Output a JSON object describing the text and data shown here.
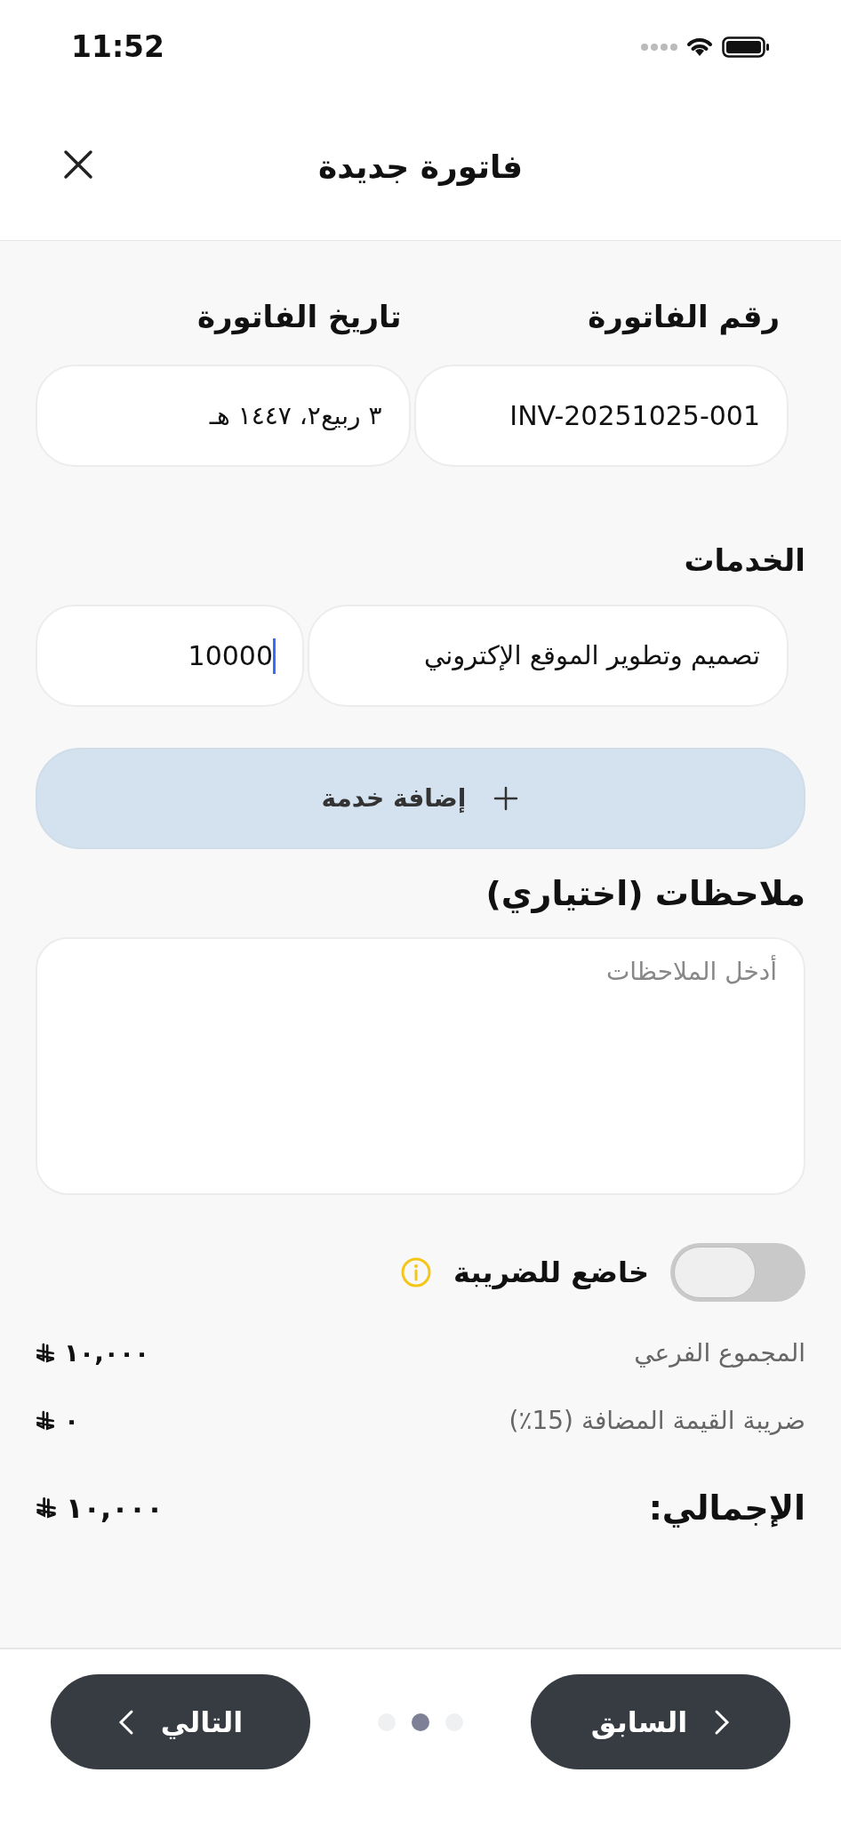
{
  "status_bar": {
    "time": "11:52"
  },
  "header": {
    "title": "فاتورة جديدة"
  },
  "invoice": {
    "number_label": "رقم الفاتورة",
    "number_value": "INV-20251025-001",
    "date_label": "تاريخ الفاتورة",
    "date_value": "٣ ربيع٢، ١٤٤٧ هـ"
  },
  "services": {
    "label": "الخدمات",
    "items": [
      {
        "name": "تصميم وتطوير الموقع الإكتروني",
        "amount": "10000",
        "focused": true
      }
    ],
    "add_button": "إضافة خدمة"
  },
  "notes": {
    "label": "ملاحظات (اختياري)",
    "placeholder": "أدخل الملاحظات"
  },
  "tax_toggle": {
    "label": "خاضع للضريبة",
    "on": false
  },
  "totals": [
    {
      "kind": "line",
      "label": "المجموع الفرعي",
      "amount": "١٠,٠٠٠"
    },
    {
      "kind": "line",
      "label": "ضريبة القيمة المضافة (15٪)",
      "amount": "٠"
    },
    {
      "kind": "grand",
      "label": "الإجمالي:",
      "amount": "١٠,٠٠٠"
    }
  ],
  "footer": {
    "previous": "السابق",
    "next": "التالي",
    "steps": [
      {
        "selected": false
      },
      {
        "selected": true
      },
      {
        "selected": false
      }
    ]
  }
}
